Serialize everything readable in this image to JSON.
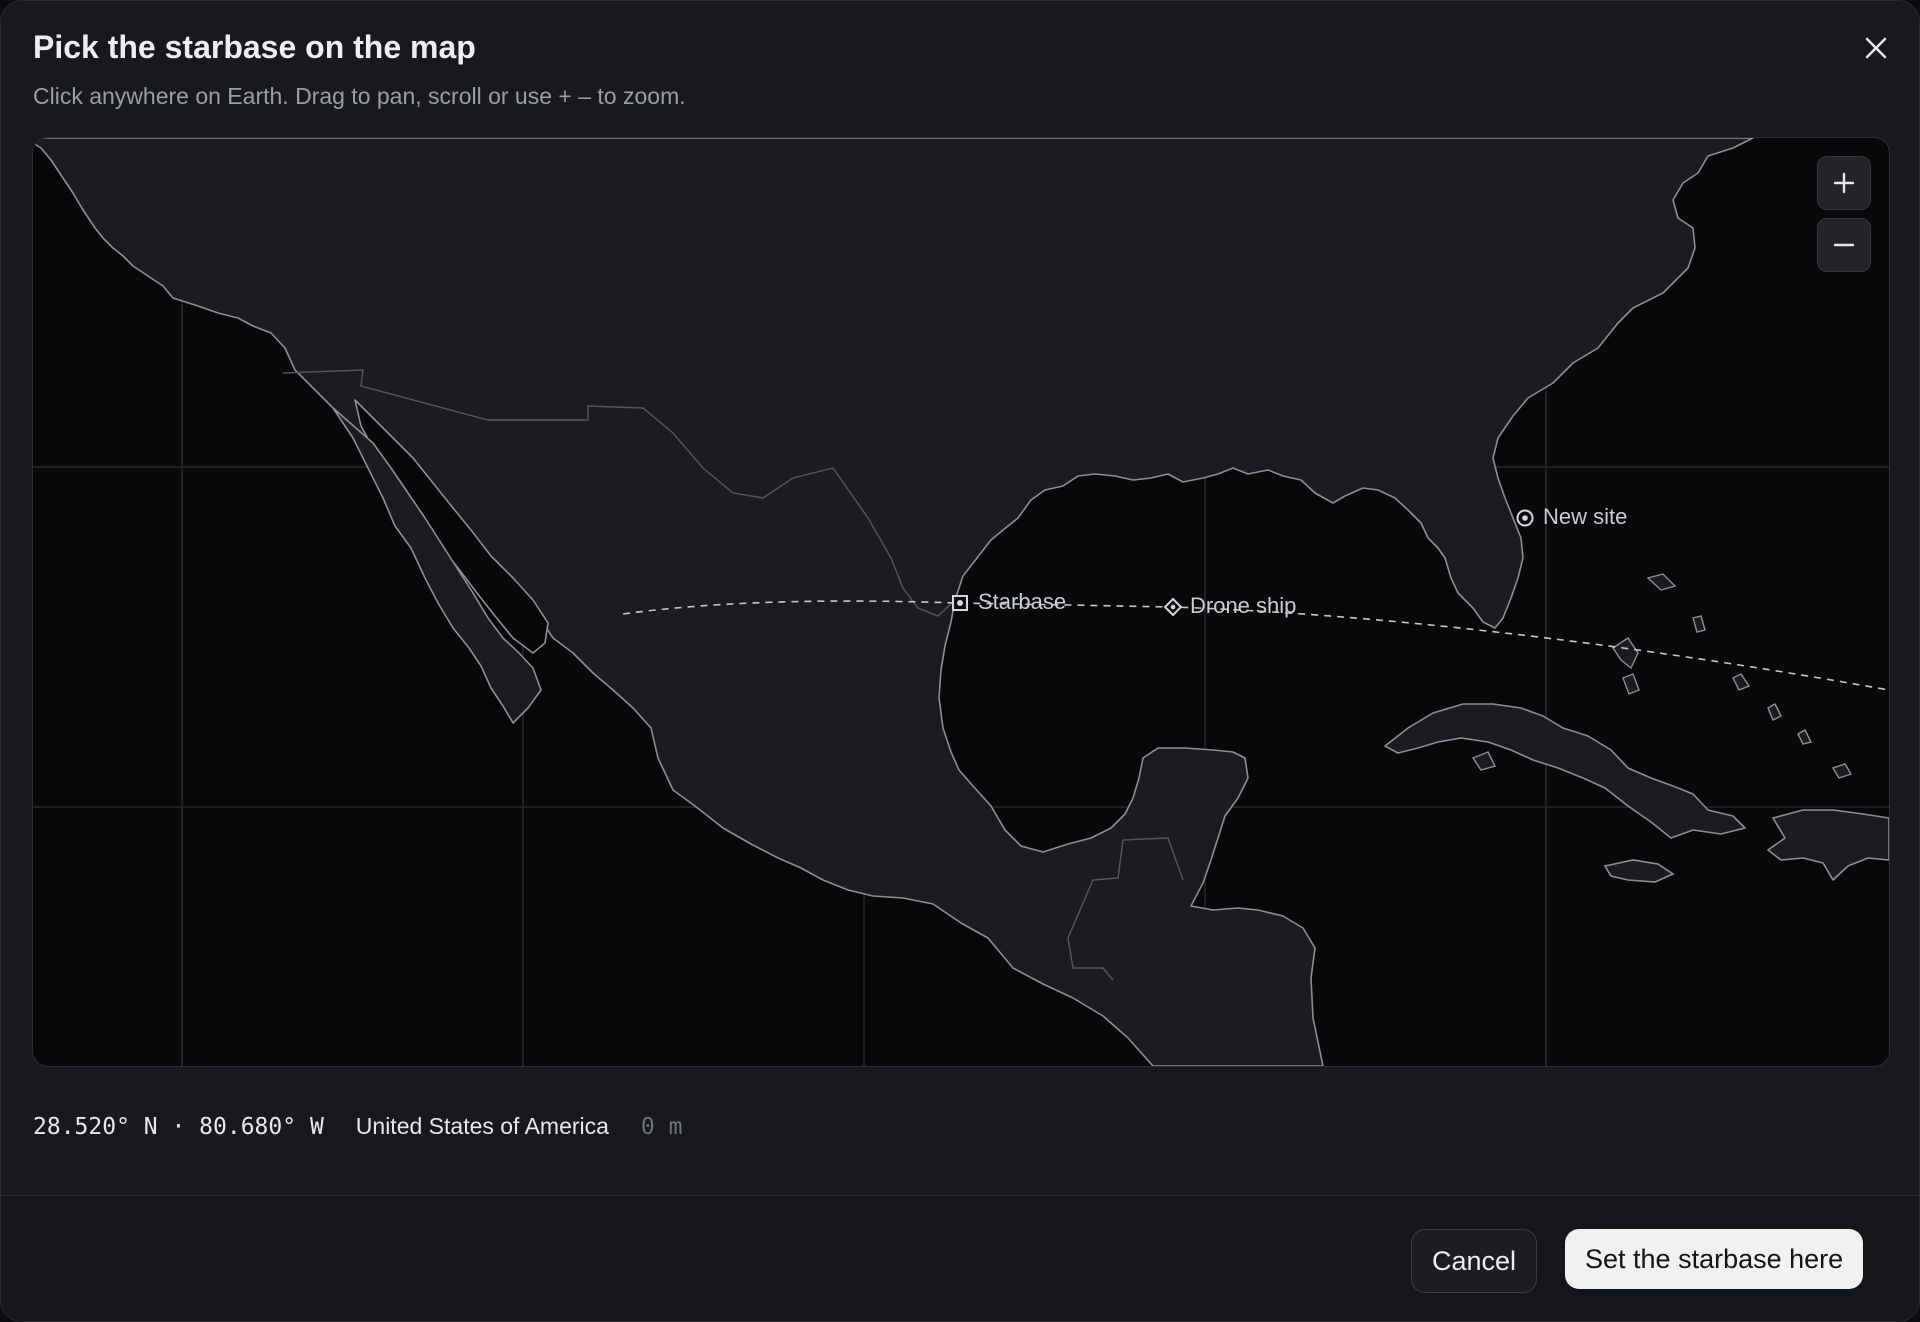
{
  "dialog": {
    "title": "Pick the starbase on the map",
    "subtitle": "Click anywhere on Earth. Drag to pan, scroll or use + – to zoom.",
    "close_icon": "close-icon"
  },
  "map": {
    "zoom_in_label": "+",
    "zoom_out_label": "–",
    "markers": {
      "starbase": "Starbase",
      "drone_ship": "Drone ship",
      "new_site": "New site"
    },
    "colors": {
      "ocean": "#070809",
      "land": "#1b1c1f",
      "coastline": "#8a8d92",
      "grid": "#2a2c30"
    }
  },
  "readout": {
    "coords": "28.520° N · 80.680° W",
    "country": "United States of America",
    "elevation": "0 m"
  },
  "footer": {
    "cancel_label": "Cancel",
    "confirm_label": "Set the starbase here"
  }
}
